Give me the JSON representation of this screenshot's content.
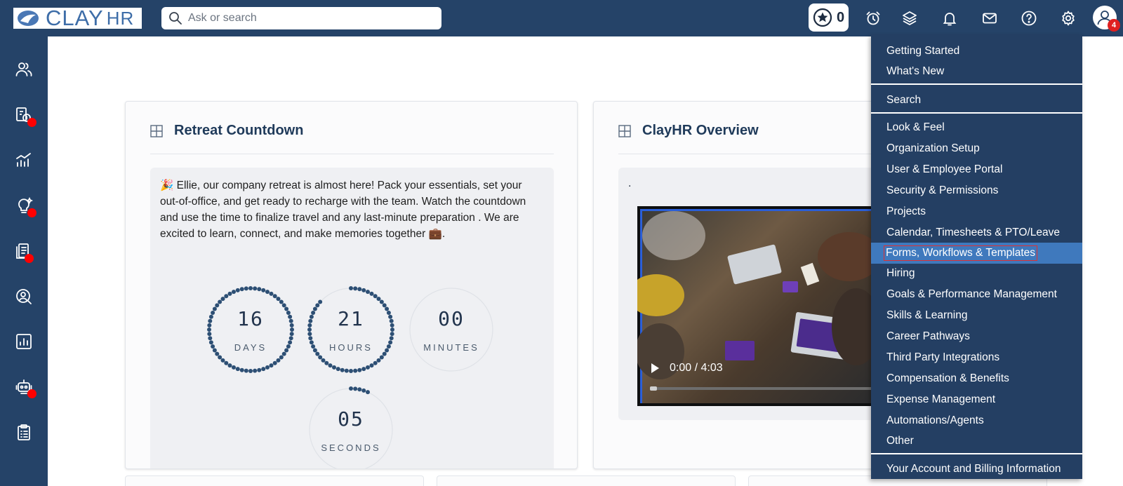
{
  "app": {
    "logo_text": "CLAY",
    "logo_suffix": "HR"
  },
  "search": {
    "placeholder": "Ask or search"
  },
  "topbar": {
    "star_count": "0",
    "avatar_badge": "4",
    "icons": [
      "star-icon",
      "alarm-clock-icon",
      "layers-icon",
      "bell-icon",
      "mail-icon",
      "help-icon",
      "gear-icon",
      "user-avatar-icon"
    ]
  },
  "sidebar": {
    "items": [
      {
        "icon": "people-icon",
        "badge": false
      },
      {
        "icon": "payroll-icon",
        "badge": true
      },
      {
        "icon": "bar-chart-icon",
        "badge": false
      },
      {
        "icon": "lightbulb-icon",
        "badge": true
      },
      {
        "icon": "documents-icon",
        "badge": true
      },
      {
        "icon": "user-search-icon",
        "badge": false
      },
      {
        "icon": "report-icon",
        "badge": false
      },
      {
        "icon": "robot-icon",
        "badge": true
      },
      {
        "icon": "clipboard-icon",
        "badge": false
      }
    ],
    "badge_color": "#ff0000"
  },
  "retreat_card": {
    "title": "Retreat Countdown",
    "message_emoji_start": "🎉",
    "message": "Ellie, our company retreat is almost here! Pack your essentials, set your out-of-office, and get ready to recharge with the team. Watch the countdown and use the time to finalize travel and any last-minute preparation   . We are excited to learn, connect, and make memories together",
    "message_emoji_end": "💼",
    "message_end": ".",
    "countdown": [
      {
        "value": "16",
        "label": "DAYS",
        "fraction": 1.0
      },
      {
        "value": "21",
        "label": "HOURS",
        "fraction": 0.875
      },
      {
        "value": "00",
        "label": "MINUTES",
        "fraction": 0.0
      },
      {
        "value": "05",
        "label": "SECONDS",
        "fraction": 0.083
      }
    ]
  },
  "overview_card": {
    "title": "ClayHR Overview",
    "caption": ".",
    "video": {
      "time": "0:00 / 4:03",
      "progress": 0.0
    }
  },
  "menu": {
    "groups": [
      [
        "Getting Started",
        "What's New"
      ],
      [
        "Search"
      ],
      [
        "Look & Feel",
        "Organization Setup",
        "User & Employee Portal",
        "Security & Permissions",
        "Projects",
        "Calendar, Timesheets & PTO/Leave",
        "Forms, Workflows & Templates",
        "Hiring",
        "Goals & Performance Management",
        "Skills & Learning",
        "Career Pathways",
        "Third Party Integrations",
        "Compensation & Benefits",
        "Expense Management",
        "Automations/Agents",
        "Other"
      ],
      [
        "Your Account and Billing Information"
      ]
    ],
    "active_item": "Forms, Workflows & Templates"
  },
  "colors": {
    "brand_navy": "#254368",
    "menu_bg": "#243f63",
    "menu_active": "#3f79bd",
    "highlight_border": "#e03030"
  }
}
